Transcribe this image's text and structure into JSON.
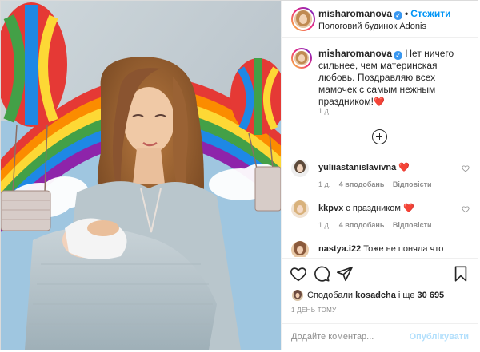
{
  "header": {
    "username": "misharomanova",
    "separator": "•",
    "follow_label": "Стежити",
    "location": "Пологовий будинок Adonis"
  },
  "caption": {
    "username": "misharomanova",
    "text": "Нет ничего сильнее, чем материнская любовь. Поздравляю всех мамочек с самым нежным праздником!",
    "emoji": "❤️",
    "time": "1 д."
  },
  "comments": [
    {
      "username": "yuliiastanislavivna",
      "text": "",
      "emoji": "❤️",
      "time": "1 д.",
      "likes": "4 вподобань",
      "reply": "Відповісти"
    },
    {
      "username": "kkpvx",
      "text": "с праздником",
      "emoji": "❤️",
      "time": "1 д.",
      "likes": "4 вподобань",
      "reply": "Відповісти"
    },
    {
      "username": "nastya.i22",
      "text": "Тоже не поняла что",
      "emoji": "",
      "time": "",
      "likes": "",
      "reply": ""
    }
  ],
  "likes": {
    "prefix": "Сподобали",
    "user": "kosadcha",
    "middle": "і ще",
    "count": "30 695"
  },
  "posted_ago": "1 ДЕНЬ ТОМУ",
  "add_comment": {
    "placeholder": "Додайте коментар...",
    "publish_label": "Опублікувати"
  },
  "icons": {
    "heart": "heart-icon",
    "comment": "comment-icon",
    "share": "share-icon",
    "save": "bookmark-icon",
    "load_more": "plus-circle-icon"
  },
  "colors": {
    "accent": "#0095f6",
    "verified": "#3897f0",
    "like_red": "#ed4956",
    "muted": "#8e8e8e"
  }
}
